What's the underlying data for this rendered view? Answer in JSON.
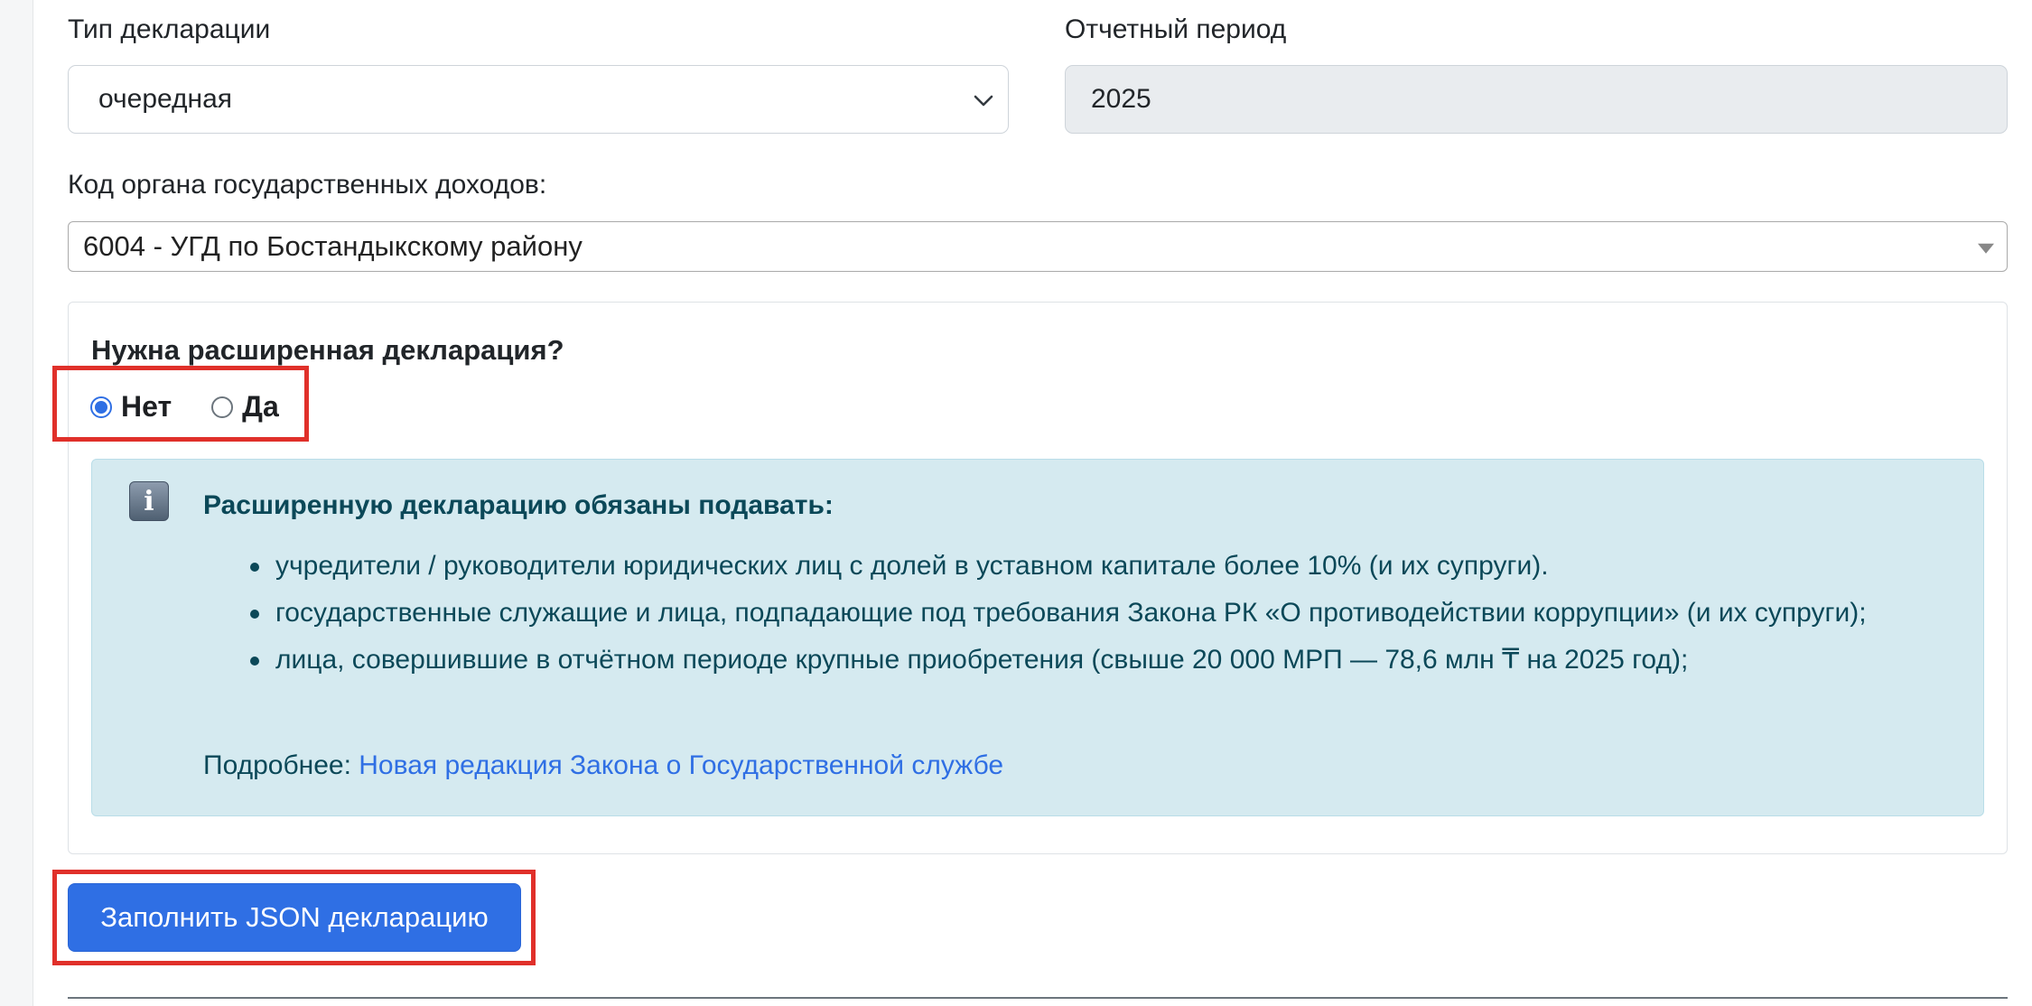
{
  "form": {
    "declaration_type": {
      "label": "Тип декларации",
      "selected": "очередная",
      "icon": "chevron-down-icon"
    },
    "reporting_period": {
      "label": "Отчетный период",
      "value": "2025"
    },
    "tax_authority": {
      "label": "Код органа государственных доходов:",
      "selected": "6004 - УГД по Бостандыкскому району",
      "icon": "caret-down-icon"
    }
  },
  "extended": {
    "question": "Нужна расширенная декларация?",
    "options": [
      {
        "label": "Нет",
        "checked": true
      },
      {
        "label": "Да",
        "checked": false
      }
    ],
    "highlight_color": "#e0302a"
  },
  "info_alert": {
    "icon": "info-icon",
    "title": "Расширенную декларацию обязаны подавать:",
    "items": [
      "учредители / руководители юридических лиц с долей в уставном капитале более 10% (и их супруги).",
      "государственные служащие и лица, подпадающие под требования Закона РК «О противодействии коррупции» (и их супруги);",
      "лица, совершившие в отчётном периоде крупные приобретения (свыше 20 000 МРП — 78,6 млн ₸ на 2025 год);"
    ],
    "more_label": "Подробнее:",
    "more_link": "Новая редакция Закона о Государственной службе",
    "background": "#d5eaf0",
    "text_color": "#0b4858"
  },
  "actions": {
    "fill_json_label": "Заполнить JSON декларацию",
    "button_color": "#2f6fe4"
  }
}
